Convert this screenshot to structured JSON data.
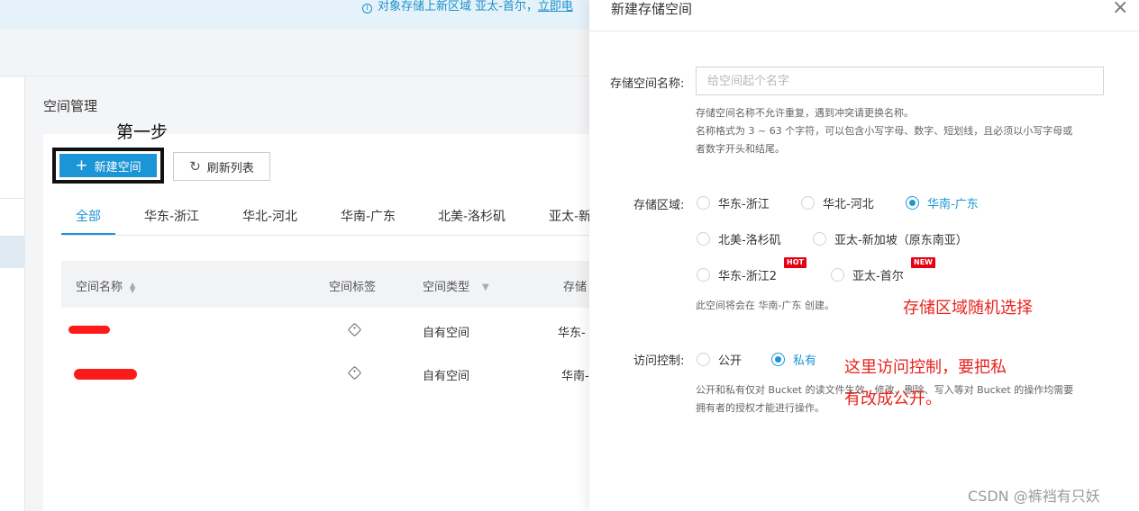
{
  "notice": {
    "text": "对象存储上新区域 亚太-首尔，",
    "link": "立即电"
  },
  "section_title": "空间管理",
  "step_annotation": "第一步",
  "toolbar": {
    "create_label": "新建空间",
    "refresh_label": "刷新列表"
  },
  "region_tabs": [
    "全部",
    "华东-浙江",
    "华北-河北",
    "华南-广东",
    "北美-洛杉矶",
    "亚太-新"
  ],
  "table": {
    "headers": [
      "空间名称",
      "空间标签",
      "空间类型",
      "存储"
    ],
    "rows": [
      {
        "type": "自有空间",
        "region": "华东-"
      },
      {
        "type": "自有空间",
        "region": "华南-"
      }
    ]
  },
  "drawer": {
    "title": "新建存储空间",
    "name_label": "存储空间名称:",
    "name_placeholder": "给空间起个名字",
    "name_hint_1": "存储空间名称不允许重复，遇到冲突请更换名称。",
    "name_hint_2": "名称格式为 3 ~ 63 个字符，可以包含小写字母、数字、短划线，且必须以小写字母或",
    "name_hint_3": "者数字开头和结尾。",
    "region_label": "存储区域:",
    "regions": [
      {
        "label": "华东-浙江",
        "checked": false
      },
      {
        "label": "华北-河北",
        "checked": false
      },
      {
        "label": "华南-广东",
        "checked": true
      },
      {
        "label": "北美-洛杉矶",
        "checked": false
      },
      {
        "label": "亚太-新加坡（原东南亚）",
        "checked": false
      },
      {
        "label": "华东-浙江2",
        "checked": false,
        "badge": "HOT"
      },
      {
        "label": "亚太-首尔",
        "checked": false,
        "badge": "NEW"
      }
    ],
    "region_hint": "此空间将会在 华南-广东 创建。",
    "access_label": "访问控制:",
    "access_options": [
      {
        "label": "公开",
        "checked": false
      },
      {
        "label": "私有",
        "checked": true
      }
    ],
    "access_hint_1": "公开和私有仅对 Bucket 的读文件生效，修改、删除、写入等对 Bucket 的操作均需要",
    "access_hint_2": "拥有者的授权才能进行操作。"
  },
  "annotations": {
    "region": "存储区域随机选择",
    "access_1": "这里访问控制，要把私",
    "access_2": "有改成公开。"
  },
  "watermark": "CSDN @裤裆有只妖",
  "colors": {
    "primary": "#1c95d6",
    "annotation": "#e8231f",
    "badge": "#e60012"
  }
}
